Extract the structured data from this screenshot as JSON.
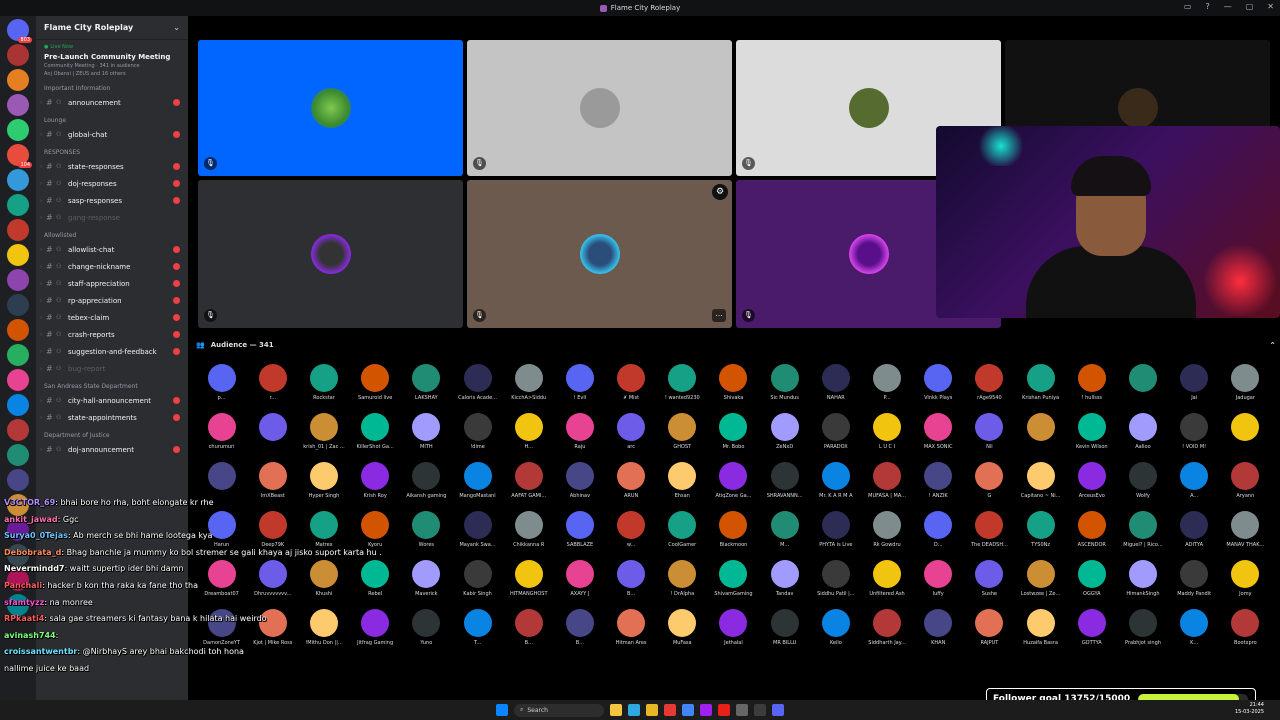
{
  "window": {
    "title": "Flame City Roleplay"
  },
  "server": {
    "name": "Flame City Roleplay"
  },
  "live_event": {
    "status": "Live Now",
    "title": "Pre-Launch Community Meeting",
    "subtitle": "Community Meeting · 341 in audience",
    "people": "Anj Obansi | ZEUS and 16 others"
  },
  "sidebar": {
    "sections": [
      {
        "category": "Important Information",
        "channels": [
          {
            "name": "announcement",
            "unread": true,
            "badge": ""
          }
        ]
      },
      {
        "category": "Lounge",
        "channels": [
          {
            "name": "global-chat",
            "unread": true,
            "badge": ""
          }
        ]
      },
      {
        "category": "RESPONSES",
        "channels": [
          {
            "name": "state-responses",
            "unread": true,
            "badge": ""
          },
          {
            "name": "doj-responses",
            "unread": true,
            "badge": ""
          },
          {
            "name": "sasp-responses",
            "unread": true,
            "badge": ""
          },
          {
            "name": "gang-response",
            "unread": false,
            "badge": ""
          }
        ]
      },
      {
        "category": "Allowlisted",
        "channels": [
          {
            "name": "allowlist-chat",
            "unread": true,
            "badge": ""
          },
          {
            "name": "change-nickname",
            "unread": true,
            "badge": ""
          },
          {
            "name": "staff-appreciation",
            "unread": true,
            "badge": ""
          },
          {
            "name": "rp-appreciation",
            "unread": true,
            "badge": ""
          },
          {
            "name": "tebex-claim",
            "unread": true,
            "badge": ""
          },
          {
            "name": "crash-reports",
            "unread": true,
            "badge": ""
          },
          {
            "name": "suggestion-and-feedback",
            "unread": true,
            "badge": ""
          },
          {
            "name": "bug-report",
            "unread": false,
            "badge": ""
          }
        ]
      },
      {
        "category": "San Andreas State Department",
        "channels": [
          {
            "name": "city-hall-announcement",
            "unread": true,
            "badge": ""
          },
          {
            "name": "state-appointments",
            "unread": true,
            "badge": ""
          }
        ]
      },
      {
        "category": "Department of Justice",
        "channels": [
          {
            "name": "doj-announcement",
            "unread": true,
            "badge": ""
          }
        ]
      }
    ]
  },
  "audience": {
    "label": "Audience — 341"
  },
  "audience_members": [
    [
      "p...",
      "r...",
      "Rockstar",
      "Samuroid live",
      "LAKSHAY",
      "Caloris Acade...",
      "KicchA>Siddu",
      "! Evll",
      "✗ Mist",
      "! wanted9230",
      "Shivaka",
      "Sic Mundus",
      "NAHAR",
      "P...",
      "Vinkk Plays",
      "rAge9540",
      "Krishan Puniya",
      "! hullsss",
      "",
      "Jai",
      "Jadugar"
    ],
    [
      "churumuri",
      "",
      "krish_01 | Zac ...",
      "KillerShot Ga...",
      "MITH",
      "!dime",
      "H...",
      "Raju",
      "arc",
      "GHOST",
      "Mr. Bobo",
      "ZeNxD",
      "PARADOX",
      "L U C I",
      "MAX SONIC",
      "Nil",
      "",
      "Kevin Wilson",
      "Aalloo",
      "! VOID M!",
      ""
    ],
    [
      "",
      "ImXBeast",
      "Hyper Singh",
      "Krish Roy",
      "Aikansh gaming",
      "MangoMastani",
      "AAFAT GAMI...",
      "Abhinav",
      "ARUN",
      "Ehsan",
      "AtiqZone Ga...",
      "SHRAVANNN...",
      "Mr. K A R M A",
      "MUFASA | MA...",
      "! ANZIK",
      "G",
      "Capitano ~ Ni...",
      "ArceusEvo",
      "Wolfy",
      "A...",
      "Aryann"
    ],
    [
      "Harun",
      "Deep79K",
      "Matrex",
      "Kyoru",
      "Wores",
      "Mayank Swa...",
      "Chikkanna R",
      "SABBLAZE",
      "w...",
      "CoolGamer",
      "Blackmoon",
      "M...",
      "PHYTA is Live",
      "Rk Gowdru",
      "D...",
      "The DEADSH...",
      "TYS0Nz",
      "ASCENDOR",
      "Miguel? | Rico...",
      "ADITYA",
      "MANAV THAK..."
    ],
    [
      "Dreamboat07",
      "Dhruvvvvvvv...",
      "Khushi",
      "Rebel",
      "Maverick",
      "Kabir Singh",
      "HITMANGHOST",
      "AXAYY J",
      "B...",
      "! DrAlpha",
      "ShivamGaming",
      "Tandav",
      "Siddhu Patil |...",
      "Unfiltered Ash",
      "luffy",
      "Sushe",
      "Lostwzee | Ze...",
      "OGGYA",
      "HimankSingh",
      "Maddy Pandit",
      "Jomy"
    ],
    [
      "DamonZoneYT",
      "Kjot | Mike Ross",
      "!Mithu Don ||...",
      "Jitfrag Gaming",
      "Yuno",
      "T...",
      "B...",
      "B...",
      "Hitman Ares",
      "MuFasa",
      "Jethalal",
      "MR BILLU",
      "Keilo",
      "Siddharth Jay...",
      "KHAN",
      "RAJPUT",
      "Huzaifa Basra",
      "GOTTYA",
      "Prabhjot singh",
      "K...",
      "Bootxpro"
    ]
  ],
  "chat": [
    {
      "user": "V3CTOR_69",
      "user_color": "#b48cff",
      "text": "bhai bore ho rha, boht elongate kr rhe"
    },
    {
      "user": "ankit_jawad",
      "user_color": "#ff6fb0",
      "text": "Ggc"
    },
    {
      "user": "Surya0_0Tejas",
      "user_color": "#6fc3ff",
      "text": "Ab merch se bhi hame lootega kya"
    },
    {
      "user": "Debobrata_d",
      "user_color": "#ff8a5c",
      "text": "Bhag banchle ja mummy ko bol stremer se gali khaya aj jisko suport karta hu ."
    },
    {
      "user": "Nevermindd7",
      "user_color": "#ffffff",
      "text": "waitt supertip ider bhi damn"
    },
    {
      "user": "Panchali",
      "user_color": "#ff5c5c",
      "text": "hacker b kon tha raka ka fane tho tha"
    },
    {
      "user": "sfamtyzz",
      "user_color": "#ff4fd8",
      "text": "na monree"
    },
    {
      "user": "RPkaati4",
      "user_color": "#ff5c5c",
      "text": "sala gae streamers ki fantasy bana k hilata hai weirdo"
    },
    {
      "user": "avinash744",
      "user_color": "#7cff7c",
      "text": ""
    },
    {
      "user": "croissantwentbr",
      "user_color": "#6fe3ff",
      "text": "@NirbhayS arey bhai bakchodi toh hona"
    },
    {
      "user": "",
      "user_color": "#ffffff",
      "text": "nallime juice ke baad"
    }
  ],
  "follower_goal": {
    "label": "Follower goal 13752/15000",
    "current": 13752,
    "target": 15000
  },
  "taskbar": {
    "search_placeholder": "Search",
    "time": "21:44",
    "date": "15-03-2025"
  },
  "colors": {
    "accent": "#5865f2",
    "live": "#23a55a",
    "goal_fill": "#c7f23a"
  }
}
